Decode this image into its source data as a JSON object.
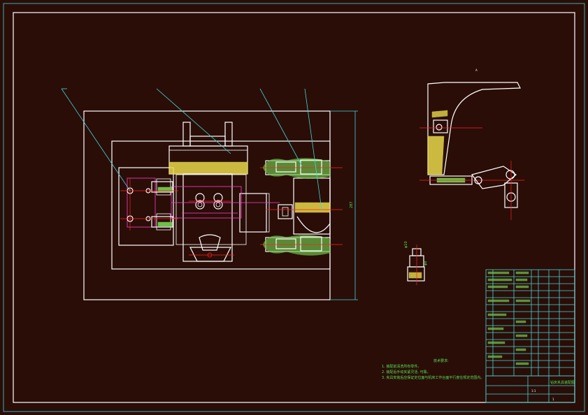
{
  "drawing": {
    "background": "#2a0d07",
    "accent_colors": {
      "outline": "#ffffff",
      "dimension": "#3fd6d6",
      "hidden": "#ff3fd0",
      "center": "#ff2020",
      "hatch": "#e9d84a",
      "note_text": "#55e055"
    }
  },
  "technical_requirements": {
    "heading": "技术要求:",
    "items": [
      "1. 装配前清洗所有零件。",
      "2. 装配后手动夹紧灵活, 可靠。",
      "3. 夹具安装后应保证定位面与机床工作台面平行度在规定范围内。"
    ]
  },
  "dimension_labels": {
    "overall_height": "287",
    "detail_a": "φ10",
    "detail_b": "φ8"
  },
  "title_block": {
    "drawing_name": "钻床夹具装配图",
    "scale": "1:1",
    "sheet": "1"
  }
}
